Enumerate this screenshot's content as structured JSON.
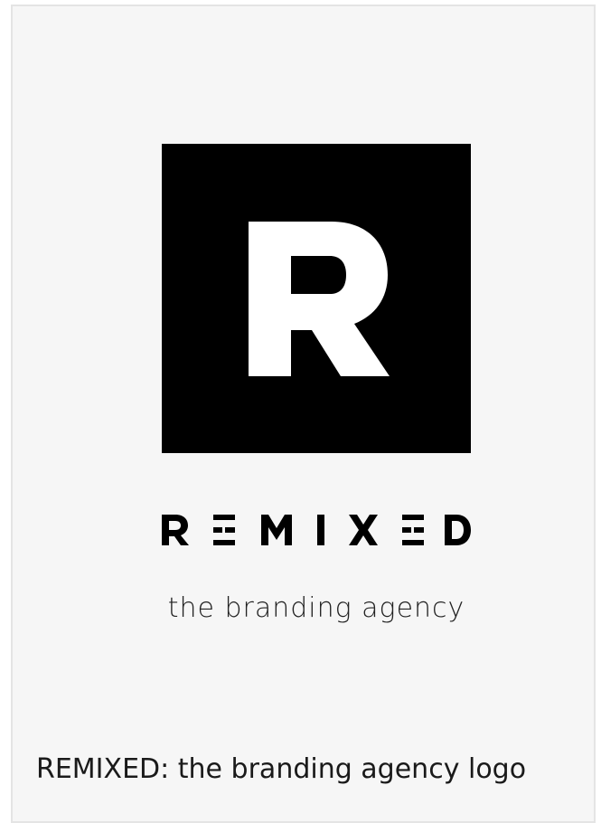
{
  "logo": {
    "monogram": "R",
    "wordmark": "REMIXED",
    "tagline": "the branding agency",
    "colors": {
      "square": "#000000",
      "monogram": "#ffffff",
      "wordmark": "#000000",
      "background": "#f6f6f6"
    }
  },
  "caption": "REMIXED: the branding agency logo"
}
